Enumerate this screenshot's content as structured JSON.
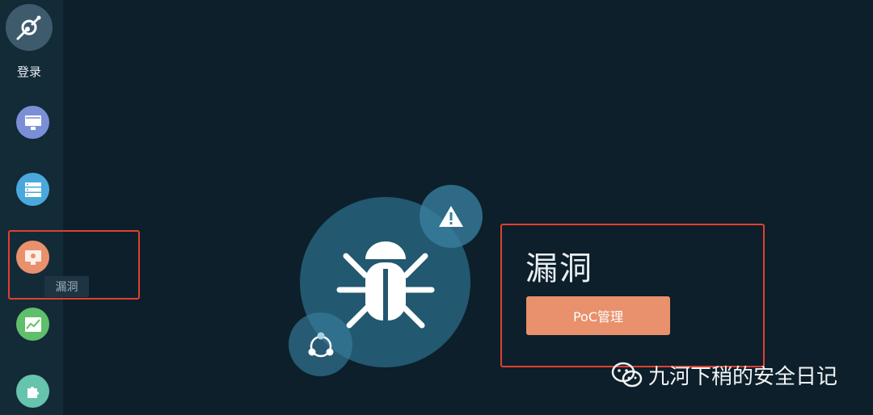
{
  "sidebar": {
    "login_label": "登录",
    "items": [
      {
        "name": "asset",
        "icon": "monitor-icon",
        "color": "#7a8fd6"
      },
      {
        "name": "server",
        "icon": "server-icon",
        "color": "#4aa8dd"
      },
      {
        "name": "vulnerability",
        "icon": "bug-monitor-icon",
        "color": "#e8916c"
      },
      {
        "name": "report",
        "icon": "chart-icon",
        "color": "#5fbf6a"
      },
      {
        "name": "plugin",
        "icon": "puzzle-icon",
        "color": "#66c3ad"
      }
    ],
    "tooltip": "漏洞"
  },
  "main": {
    "title": "漏洞",
    "poc_button": "PoC管理"
  },
  "watermark": {
    "text": "九河下稍的安全日记",
    "icon": "wechat-icon"
  },
  "colors": {
    "background": "#0d1f2a",
    "sidebar": "#132a37",
    "accent": "#e8916c",
    "highlight": "#e1402e"
  }
}
